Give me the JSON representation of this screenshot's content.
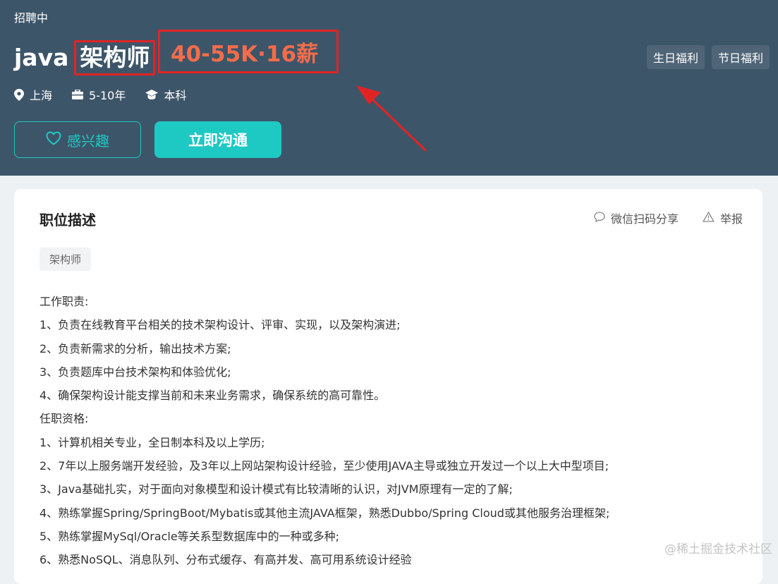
{
  "header": {
    "status": "招聘中",
    "title_prefix": "java",
    "title_highlight": "架构师",
    "salary": "40-55K·16薪",
    "benefits": [
      "生日福利",
      "节日福利"
    ],
    "meta": {
      "location": "上海",
      "experience": "5-10年",
      "education": "本科"
    },
    "interest_label": "感兴趣",
    "chat_label": "立即沟通"
  },
  "card": {
    "title": "职位描述",
    "share_label": "微信扫码分享",
    "report_label": "举报",
    "tag": "架构师",
    "lines": [
      "工作职责:",
      "1、负责在线教育平台相关的技术架构设计、评审、实现，以及架构演进;",
      "2、负责新需求的分析，输出技术方案;",
      "3、负责题库中台技术架构和体验优化;",
      "4、确保架构设计能支撑当前和未来业务需求，确保系统的高可靠性。",
      "任职资格:",
      "1、计算机相关专业，全日制本科及以上学历;",
      "2、7年以上服务端开发经验，及3年以上网站架构设计经验，至少使用JAVA主导或独立开发过一个以上大中型项目;",
      "3、Java基础扎实，对于面向对象模型和设计模式有比较清晰的认识，对JVM原理有一定的了解;",
      "4、熟练掌握Spring/SpringBoot/Mybatis或其他主流JAVA框架，熟悉Dubbo/Spring Cloud或其他服务治理框架;",
      "5、熟练掌握MySql/Oracle等关系型数据库中的一种或多种;",
      "6、熟悉NoSQL、消息队列、分布式缓存、有高并发、高可用系统设计经验"
    ]
  },
  "watermark": "@稀土掘金技术社区",
  "colors": {
    "header_bg": "#3d5569",
    "accent": "#1ec9c3",
    "salary": "#f26d4a",
    "annotation": "#e02424"
  }
}
